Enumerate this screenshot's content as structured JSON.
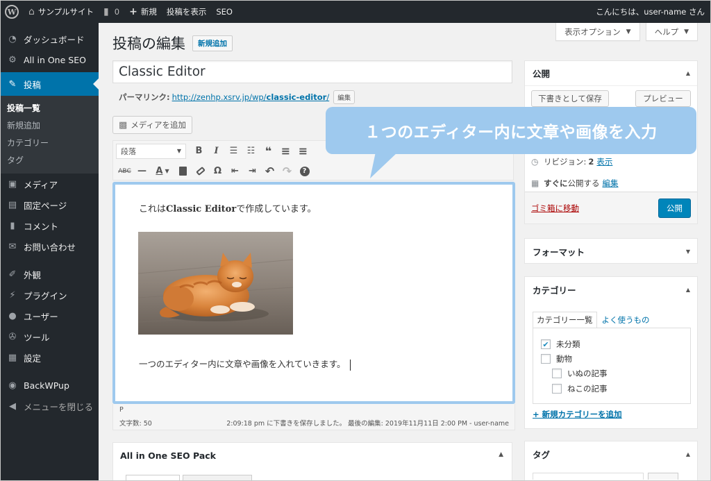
{
  "adminbar": {
    "logo": "W",
    "site_name": "サンプルサイト",
    "comments_count": "0",
    "new_label": "新規",
    "view_post": "投稿を表示",
    "seo_label": "SEO",
    "greeting": "こんにちは、user-name さん"
  },
  "sidebar": {
    "dashboard": "ダッシュボード",
    "aioseo": "All in One SEO",
    "posts": "投稿",
    "submenu": {
      "all_posts": "投稿一覧",
      "add_new": "新規追加",
      "categories": "カテゴリー",
      "tags": "タグ"
    },
    "media": "メディア",
    "pages": "固定ページ",
    "comments": "コメント",
    "contact": "お問い合わせ",
    "appearance": "外観",
    "plugins": "プラグイン",
    "users": "ユーザー",
    "tools": "ツール",
    "settings": "設定",
    "backwpup": "BackWPup",
    "collapse": "メニューを閉じる"
  },
  "screen_options": "表示オプション",
  "help": "ヘルプ",
  "page": {
    "title": "投稿の編集",
    "add_new": "新規追加"
  },
  "post": {
    "title": "Classic Editor",
    "permalink_label": "パーマリンク:",
    "permalink_prefix": "http://zenhp.xsrv.jp/wp/",
    "permalink_slug": "classic-editor",
    "permalink_suffix": "/",
    "edit_permalink": "編集",
    "add_media": "メディアを追加",
    "format": "段落",
    "content_line1_pre": "これは",
    "content_line1_bold": "Classic Editor",
    "content_line1_post": "で作成しています。",
    "content_line2": "一つのエディター内に文章や画像を入れていきます。"
  },
  "toolbar": {
    "bold": "B",
    "italic": "I",
    "ul": "☰",
    "ol": "☷",
    "quote": "❝",
    "align_left": "≡",
    "align_center": "≡",
    "strike": "ABC",
    "hr": "—",
    "text_color": "A",
    "paste": "📋",
    "clear": "⌫",
    "omega": "Ω",
    "outdent": "⇤",
    "indent": "⇥",
    "undo": "↶",
    "redo": "↷",
    "help": "?"
  },
  "status": {
    "path": "P",
    "word_count": "文字数: 50",
    "saved": "2:09:18 pm に下書きを保存しました。 最後の編集: 2019年11月11日 2:00 PM - user-name"
  },
  "seo_box": {
    "title": "All in One SEO Pack"
  },
  "publish": {
    "title": "公開",
    "save_draft": "下書きとして保存",
    "preview": "プレビュー",
    "revisions_label": "リビジョン:",
    "revisions_count": "2",
    "revisions_link": "表示",
    "schedule_bold": "すぐに",
    "schedule_text": "公開する",
    "schedule_link": "編集",
    "trash": "ゴミ箱に移動",
    "publish_btn": "公開"
  },
  "format_box": {
    "title": "フォーマット"
  },
  "category_box": {
    "title": "カテゴリー",
    "tab_all": "カテゴリー一覧",
    "tab_popular": "よく使うもの",
    "items": [
      {
        "label": "未分類",
        "checked": true
      },
      {
        "label": "動物",
        "checked": false
      },
      {
        "label": "いぬの記事",
        "checked": false
      },
      {
        "label": "ねこの記事",
        "checked": false
      }
    ],
    "add_new": "+ 新規カテゴリーを追加"
  },
  "tag_box": {
    "title": "タグ"
  },
  "callout": "１つのエディター内に文章や画像を入力"
}
